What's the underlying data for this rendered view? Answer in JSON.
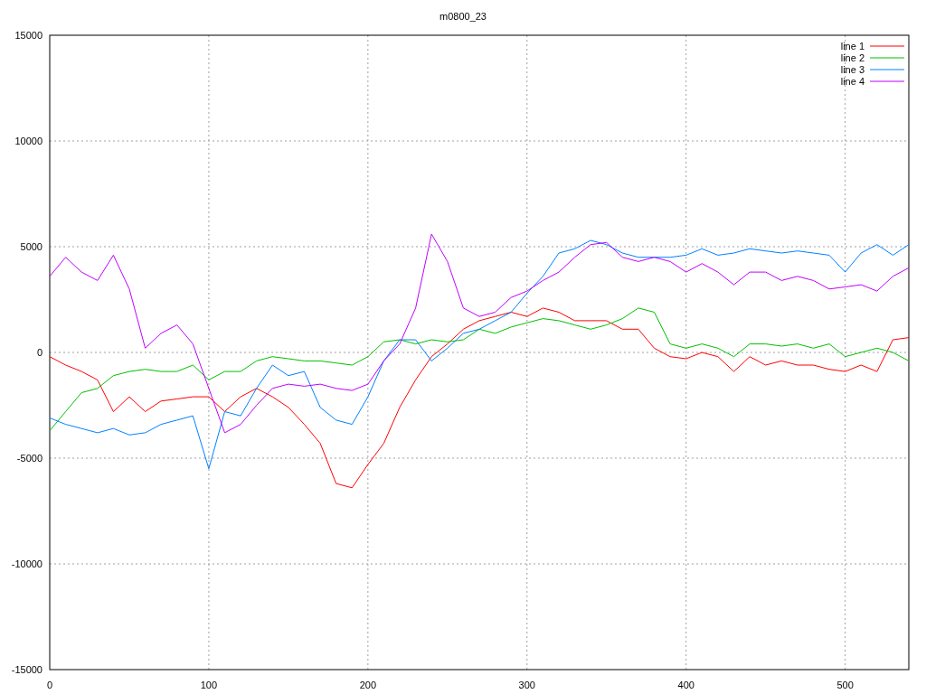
{
  "chart": {
    "chart_data": {
      "type": "line",
      "title": "m0800_23",
      "x": [
        0,
        10,
        20,
        30,
        40,
        50,
        60,
        70,
        80,
        90,
        100,
        110,
        120,
        130,
        140,
        150,
        160,
        170,
        180,
        190,
        200,
        210,
        220,
        230,
        240,
        250,
        260,
        270,
        280,
        290,
        300,
        310,
        320,
        330,
        340,
        350,
        360,
        370,
        380,
        390,
        400,
        410,
        420,
        430,
        440,
        450,
        460,
        470,
        480,
        490,
        500,
        510,
        520,
        530,
        540
      ],
      "series": [
        {
          "name": "line 1",
          "color": "#ff0000",
          "values": [
            -200,
            -600,
            -900,
            -1300,
            -2800,
            -2100,
            -2800,
            -2300,
            -2200,
            -2100,
            -2100,
            -2800,
            -2100,
            -1700,
            -2100,
            -2600,
            -3400,
            -4300,
            -6200,
            -6400,
            -5300,
            -4300,
            -2600,
            -1300,
            -200,
            400,
            1100,
            1500,
            1700,
            1900,
            1700,
            2100,
            1900,
            1500,
            1500,
            1500,
            1100,
            1100,
            200,
            -200,
            -300,
            0,
            -200,
            -900,
            -200,
            -600,
            -400,
            -600,
            -600,
            -800,
            -900,
            -600,
            -900,
            600,
            700
          ]
        },
        {
          "name": "line 2",
          "color": "#00c000",
          "values": [
            -3700,
            -2800,
            -1900,
            -1700,
            -1100,
            -900,
            -800,
            -900,
            -900,
            -600,
            -1300,
            -900,
            -900,
            -400,
            -200,
            -300,
            -400,
            -400,
            -500,
            -600,
            -200,
            500,
            600,
            400,
            600,
            500,
            600,
            1100,
            900,
            1200,
            1400,
            1600,
            1500,
            1300,
            1100,
            1300,
            1600,
            2100,
            1900,
            400,
            200,
            400,
            200,
            -200,
            400,
            400,
            300,
            400,
            200,
            400,
            -200,
            0,
            200,
            0,
            -400
          ]
        },
        {
          "name": "line 3",
          "color": "#0080ff",
          "values": [
            -3100,
            -3400,
            -3600,
            -3800,
            -3600,
            -3900,
            -3800,
            -3400,
            -3200,
            -3000,
            -5500,
            -2800,
            -3000,
            -1700,
            -600,
            -1100,
            -900,
            -2600,
            -3200,
            -3400,
            -2100,
            -400,
            600,
            600,
            -400,
            200,
            900,
            1100,
            1500,
            1900,
            2800,
            3600,
            4700,
            4900,
            5300,
            5100,
            4700,
            4500,
            4500,
            4500,
            4600,
            4900,
            4600,
            4700,
            4900,
            4800,
            4700,
            4800,
            4700,
            4600,
            3800,
            4700,
            5100,
            4600,
            5100
          ]
        },
        {
          "name": "line 4",
          "color": "#c000ff",
          "values": [
            3600,
            4500,
            3800,
            3400,
            4600,
            3000,
            200,
            900,
            1300,
            400,
            -1700,
            -3800,
            -3400,
            -2500,
            -1700,
            -1500,
            -1600,
            -1500,
            -1700,
            -1800,
            -1500,
            -400,
            400,
            2100,
            5600,
            4300,
            2100,
            1700,
            1900,
            2600,
            2900,
            3400,
            3800,
            4500,
            5100,
            5200,
            4500,
            4300,
            4500,
            4300,
            3800,
            4200,
            3800,
            3200,
            3800,
            3800,
            3400,
            3600,
            3400,
            3000,
            3100,
            3200,
            2900,
            3600,
            4000
          ]
        }
      ],
      "xlim": [
        0,
        540
      ],
      "ylim": [
        -15000,
        15000
      ],
      "grid": true,
      "legend": true,
      "xticks": [
        0,
        100,
        200,
        300,
        400,
        500
      ],
      "yticks": [
        -15000,
        -10000,
        -5000,
        0,
        5000,
        10000,
        15000
      ]
    }
  }
}
